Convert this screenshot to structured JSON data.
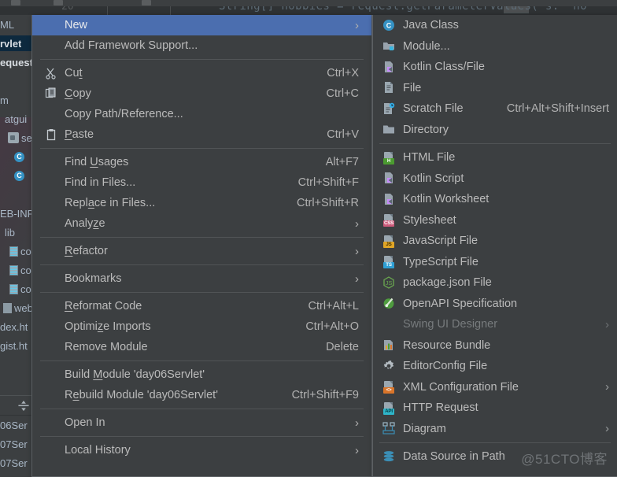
{
  "app": {
    "theme_bg": "#3c3f41",
    "highlight_color": "#4b6eaf",
    "text_color": "#bbbbbb",
    "watermark": "@51CTO博客"
  },
  "editor": {
    "line_number": "20",
    "code_line": "String[] hobbies = request.getParameterValues( s: \"ho"
  },
  "project_tree": {
    "rows": [
      {
        "label": "ML",
        "icon": "",
        "state": "normal"
      },
      {
        "label": "rvlet",
        "icon": "",
        "state": "selected"
      },
      {
        "label": "equest",
        "icon": "",
        "state": "bold"
      },
      {
        "label": "",
        "icon": "",
        "state": "normal"
      },
      {
        "label": "m",
        "icon": "",
        "state": "normal"
      },
      {
        "label": "atgui",
        "icon": "",
        "state": "normal"
      },
      {
        "label": "se",
        "icon": "folder",
        "state": "normal"
      },
      {
        "label": "",
        "icon": "jclass",
        "state": "normal"
      },
      {
        "label": "",
        "icon": "jclass",
        "state": "normal"
      },
      {
        "label": "",
        "icon": "",
        "state": "normal"
      },
      {
        "label": "EB-INF",
        "icon": "",
        "state": "normal"
      },
      {
        "label": "lib",
        "icon": "",
        "state": "normal"
      },
      {
        "label": "co",
        "icon": "jar",
        "state": "normal"
      },
      {
        "label": "co",
        "icon": "jar",
        "state": "normal"
      },
      {
        "label": "co",
        "icon": "jar",
        "state": "normal"
      },
      {
        "label": "web.x",
        "icon": "xmlf",
        "state": "normal"
      },
      {
        "label": "dex.ht",
        "icon": "",
        "state": "normal"
      },
      {
        "label": "gist.ht",
        "icon": "",
        "state": "normal"
      }
    ],
    "bottom_rows": [
      {
        "label": "06Ser"
      },
      {
        "label": "07Ser"
      },
      {
        "label": "07Ser"
      }
    ]
  },
  "context_menu": {
    "items": [
      {
        "kind": "item",
        "label": "New",
        "mnemonic": "",
        "accel": "",
        "icon": "",
        "arrow": true,
        "highlighted": true
      },
      {
        "kind": "item",
        "label": "Add Framework Support...",
        "accel": "",
        "icon": "",
        "arrow": false
      },
      {
        "kind": "separator"
      },
      {
        "kind": "item",
        "label": "Cut",
        "mnemonic": "t",
        "accel": "Ctrl+X",
        "icon": "scissors-icon",
        "arrow": false
      },
      {
        "kind": "item",
        "label": "Copy",
        "mnemonic": "C",
        "accel": "Ctrl+C",
        "icon": "copy-icon",
        "arrow": false
      },
      {
        "kind": "item",
        "label": "Copy Path/Reference...",
        "accel": "",
        "icon": "",
        "arrow": false
      },
      {
        "kind": "item",
        "label": "Paste",
        "mnemonic": "P",
        "accel": "Ctrl+V",
        "icon": "clipboard-icon",
        "arrow": false
      },
      {
        "kind": "separator"
      },
      {
        "kind": "item",
        "label": "Find Usages",
        "mnemonic": "U",
        "accel": "Alt+F7",
        "icon": "",
        "arrow": false
      },
      {
        "kind": "item",
        "label": "Find in Files...",
        "accel": "Ctrl+Shift+F",
        "icon": "",
        "arrow": false
      },
      {
        "kind": "item",
        "label": "Replace in Files...",
        "mnemonic": "a",
        "accel": "Ctrl+Shift+R",
        "icon": "",
        "arrow": false
      },
      {
        "kind": "item",
        "label": "Analyze",
        "mnemonic": "z",
        "accel": "",
        "icon": "",
        "arrow": true
      },
      {
        "kind": "separator"
      },
      {
        "kind": "item",
        "label": "Refactor",
        "mnemonic": "R",
        "accel": "",
        "icon": "",
        "arrow": true
      },
      {
        "kind": "separator"
      },
      {
        "kind": "item",
        "label": "Bookmarks",
        "accel": "",
        "icon": "",
        "arrow": true
      },
      {
        "kind": "separator"
      },
      {
        "kind": "item",
        "label": "Reformat Code",
        "mnemonic": "R",
        "accel": "Ctrl+Alt+L",
        "icon": "",
        "arrow": false
      },
      {
        "kind": "item",
        "label": "Optimize Imports",
        "mnemonic": "z",
        "accel": "Ctrl+Alt+O",
        "icon": "",
        "arrow": false
      },
      {
        "kind": "item",
        "label": "Remove Module",
        "accel": "Delete",
        "icon": "",
        "arrow": false
      },
      {
        "kind": "separator"
      },
      {
        "kind": "item",
        "label": "Build Module 'day06Servlet'",
        "mnemonic": "M",
        "accel": "",
        "icon": "",
        "arrow": false
      },
      {
        "kind": "item",
        "label": "Rebuild Module 'day06Servlet'",
        "mnemonic": "e",
        "accel": "Ctrl+Shift+F9",
        "icon": "",
        "arrow": false
      },
      {
        "kind": "separator"
      },
      {
        "kind": "item",
        "label": "Open In",
        "accel": "",
        "icon": "",
        "arrow": true
      },
      {
        "kind": "separator"
      },
      {
        "kind": "item",
        "label": "Local History",
        "accel": "",
        "icon": "",
        "arrow": true
      }
    ]
  },
  "new_submenu": {
    "items": [
      {
        "kind": "item",
        "label": "Java Class",
        "accel": "",
        "icon": "java-class-icon",
        "arrow": false,
        "disabled": false
      },
      {
        "kind": "item",
        "label": "Module...",
        "accel": "",
        "icon": "module-icon",
        "arrow": false,
        "disabled": false
      },
      {
        "kind": "item",
        "label": "Kotlin Class/File",
        "accel": "",
        "icon": "kotlin-class-icon",
        "arrow": false,
        "disabled": false
      },
      {
        "kind": "item",
        "label": "File",
        "accel": "",
        "icon": "file-icon",
        "arrow": false,
        "disabled": false
      },
      {
        "kind": "item",
        "label": "Scratch File",
        "accel": "Ctrl+Alt+Shift+Insert",
        "icon": "scratch-file-icon",
        "arrow": false,
        "disabled": false
      },
      {
        "kind": "item",
        "label": "Directory",
        "accel": "",
        "icon": "directory-icon",
        "arrow": false,
        "disabled": false
      },
      {
        "kind": "separator"
      },
      {
        "kind": "item",
        "label": "HTML File",
        "accel": "",
        "icon": "html-file-icon",
        "arrow": false,
        "disabled": false
      },
      {
        "kind": "item",
        "label": "Kotlin Script",
        "accel": "",
        "icon": "kotlin-script-icon",
        "arrow": false,
        "disabled": false
      },
      {
        "kind": "item",
        "label": "Kotlin Worksheet",
        "accel": "",
        "icon": "kotlin-worksheet-icon",
        "arrow": false,
        "disabled": false
      },
      {
        "kind": "item",
        "label": "Stylesheet",
        "accel": "",
        "icon": "css-file-icon",
        "arrow": false,
        "disabled": false
      },
      {
        "kind": "item",
        "label": "JavaScript File",
        "accel": "",
        "icon": "js-file-icon",
        "arrow": false,
        "disabled": false
      },
      {
        "kind": "item",
        "label": "TypeScript File",
        "accel": "",
        "icon": "ts-file-icon",
        "arrow": false,
        "disabled": false
      },
      {
        "kind": "item",
        "label": "package.json File",
        "accel": "",
        "icon": "nodejs-icon",
        "arrow": false,
        "disabled": false
      },
      {
        "kind": "item",
        "label": "OpenAPI Specification",
        "accel": "",
        "icon": "openapi-icon",
        "arrow": false,
        "disabled": false
      },
      {
        "kind": "item",
        "label": "Swing UI Designer",
        "accel": "",
        "icon": "",
        "arrow": true,
        "disabled": true
      },
      {
        "kind": "item",
        "label": "Resource Bundle",
        "accel": "",
        "icon": "resource-bundle-icon",
        "arrow": false,
        "disabled": false
      },
      {
        "kind": "item",
        "label": "EditorConfig File",
        "accel": "",
        "icon": "gear-icon",
        "arrow": false,
        "disabled": false
      },
      {
        "kind": "item",
        "label": "XML Configuration File",
        "accel": "",
        "icon": "xml-file-icon",
        "arrow": true,
        "disabled": false
      },
      {
        "kind": "item",
        "label": "HTTP Request",
        "accel": "",
        "icon": "http-request-icon",
        "arrow": false,
        "disabled": false
      },
      {
        "kind": "item",
        "label": "Diagram",
        "accel": "",
        "icon": "diagram-icon",
        "arrow": true,
        "disabled": false
      },
      {
        "kind": "separator"
      },
      {
        "kind": "item",
        "label": "Data Source in Path",
        "accel": "",
        "icon": "database-icon",
        "arrow": false,
        "disabled": false
      }
    ]
  }
}
